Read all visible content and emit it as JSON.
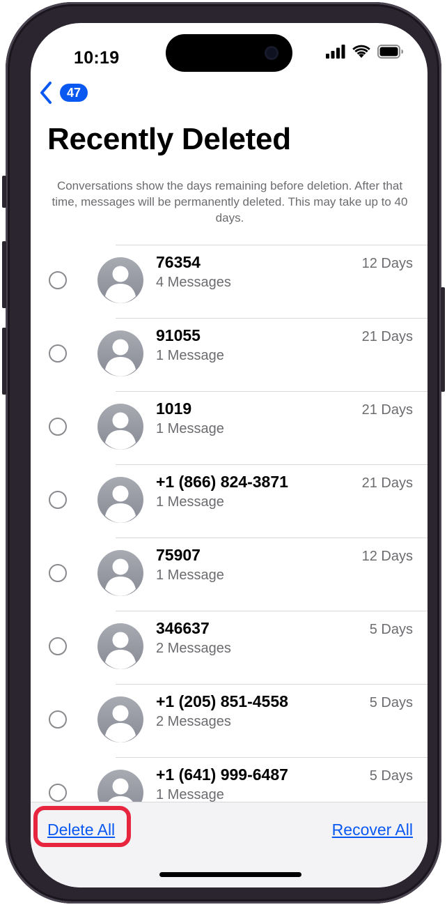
{
  "status": {
    "time": "10:19"
  },
  "nav": {
    "back_badge": "47"
  },
  "page": {
    "title": "Recently Deleted",
    "description": "Conversations show the days remaining before deletion. After that time, messages will be permanently deleted. This may take up to 40 days."
  },
  "conversations": [
    {
      "name": "76354",
      "count": "4 Messages",
      "days": "12 Days"
    },
    {
      "name": "91055",
      "count": "1 Message",
      "days": "21 Days"
    },
    {
      "name": "1019",
      "count": "1 Message",
      "days": "21 Days"
    },
    {
      "name": "+1 (866) 824-3871",
      "count": "1 Message",
      "days": "21 Days"
    },
    {
      "name": "75907",
      "count": "1 Message",
      "days": "12 Days"
    },
    {
      "name": "346637",
      "count": "2 Messages",
      "days": "5 Days"
    },
    {
      "name": "+1 (205) 851-4558",
      "count": "2 Messages",
      "days": "5 Days"
    },
    {
      "name": "+1 (641) 999-6487",
      "count": "1 Message",
      "days": "5 Days"
    }
  ],
  "toolbar": {
    "delete_all": "Delete All",
    "recover_all": "Recover All"
  },
  "colors": {
    "accent": "#0a58f2",
    "highlight": "#e8253f",
    "secondary_text": "#6c6c70"
  },
  "icons": [
    "back-chevron-icon",
    "cellular-signal-icon",
    "wifi-icon",
    "battery-icon",
    "contact-avatar-icon",
    "radio-unselected-icon"
  ]
}
